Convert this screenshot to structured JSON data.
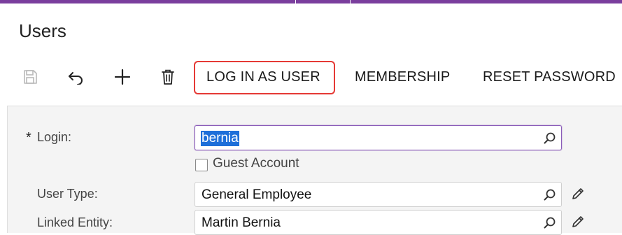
{
  "page": {
    "title": "Users"
  },
  "toolbar": {
    "icons": [
      "save-icon",
      "undo-icon",
      "add-icon",
      "delete-icon"
    ],
    "login_as_user": "LOG IN AS USER",
    "membership": "MEMBERSHIP",
    "reset_password": "RESET PASSWORD"
  },
  "form": {
    "login": {
      "required_marker": "*",
      "label": "Login:",
      "value": "bernia"
    },
    "guest_account": {
      "label": "Guest Account",
      "checked": false
    },
    "user_type": {
      "label": "User Type:",
      "value": "General Employee"
    },
    "linked_entity": {
      "label": "Linked Entity:",
      "value": "Martin Bernia"
    }
  },
  "colors": {
    "accent": "#7a3e9d",
    "highlight": "#e53935",
    "selection": "#1e6fd9"
  }
}
